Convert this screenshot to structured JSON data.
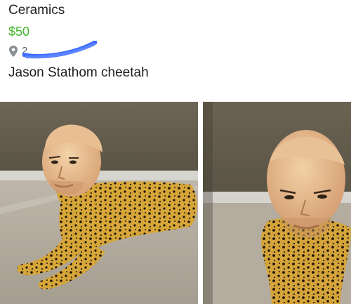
{
  "listing": {
    "category": "Ceramics",
    "price": "$50",
    "location_text": "2",
    "title": "Jason Stathom cheetah"
  },
  "icons": {
    "location": "map-pin-icon"
  },
  "colors": {
    "price": "#42b72a",
    "text": "#1c1e21",
    "muted": "#606770",
    "redaction": "#3b6bff"
  }
}
